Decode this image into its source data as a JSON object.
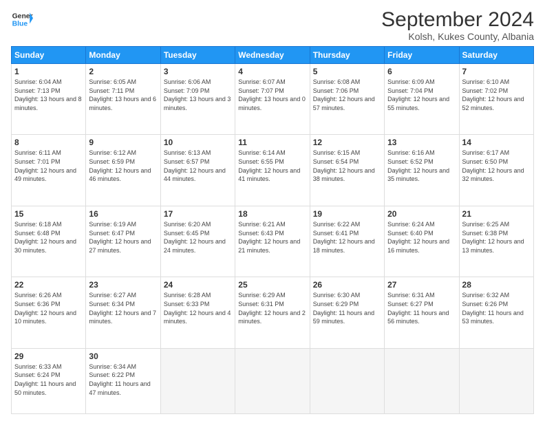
{
  "logo": {
    "general": "General",
    "blue": "Blue"
  },
  "title": "September 2024",
  "location": "Kolsh, Kukes County, Albania",
  "days_of_week": [
    "Sunday",
    "Monday",
    "Tuesday",
    "Wednesday",
    "Thursday",
    "Friday",
    "Saturday"
  ],
  "weeks": [
    [
      {
        "day": "1",
        "sunrise": "6:04 AM",
        "sunset": "7:13 PM",
        "daylight": "13 hours and 8 minutes."
      },
      {
        "day": "2",
        "sunrise": "6:05 AM",
        "sunset": "7:11 PM",
        "daylight": "13 hours and 6 minutes."
      },
      {
        "day": "3",
        "sunrise": "6:06 AM",
        "sunset": "7:09 PM",
        "daylight": "13 hours and 3 minutes."
      },
      {
        "day": "4",
        "sunrise": "6:07 AM",
        "sunset": "7:07 PM",
        "daylight": "13 hours and 0 minutes."
      },
      {
        "day": "5",
        "sunrise": "6:08 AM",
        "sunset": "7:06 PM",
        "daylight": "12 hours and 57 minutes."
      },
      {
        "day": "6",
        "sunrise": "6:09 AM",
        "sunset": "7:04 PM",
        "daylight": "12 hours and 55 minutes."
      },
      {
        "day": "7",
        "sunrise": "6:10 AM",
        "sunset": "7:02 PM",
        "daylight": "12 hours and 52 minutes."
      }
    ],
    [
      {
        "day": "8",
        "sunrise": "6:11 AM",
        "sunset": "7:01 PM",
        "daylight": "12 hours and 49 minutes."
      },
      {
        "day": "9",
        "sunrise": "6:12 AM",
        "sunset": "6:59 PM",
        "daylight": "12 hours and 46 minutes."
      },
      {
        "day": "10",
        "sunrise": "6:13 AM",
        "sunset": "6:57 PM",
        "daylight": "12 hours and 44 minutes."
      },
      {
        "day": "11",
        "sunrise": "6:14 AM",
        "sunset": "6:55 PM",
        "daylight": "12 hours and 41 minutes."
      },
      {
        "day": "12",
        "sunrise": "6:15 AM",
        "sunset": "6:54 PM",
        "daylight": "12 hours and 38 minutes."
      },
      {
        "day": "13",
        "sunrise": "6:16 AM",
        "sunset": "6:52 PM",
        "daylight": "12 hours and 35 minutes."
      },
      {
        "day": "14",
        "sunrise": "6:17 AM",
        "sunset": "6:50 PM",
        "daylight": "12 hours and 32 minutes."
      }
    ],
    [
      {
        "day": "15",
        "sunrise": "6:18 AM",
        "sunset": "6:48 PM",
        "daylight": "12 hours and 30 minutes."
      },
      {
        "day": "16",
        "sunrise": "6:19 AM",
        "sunset": "6:47 PM",
        "daylight": "12 hours and 27 minutes."
      },
      {
        "day": "17",
        "sunrise": "6:20 AM",
        "sunset": "6:45 PM",
        "daylight": "12 hours and 24 minutes."
      },
      {
        "day": "18",
        "sunrise": "6:21 AM",
        "sunset": "6:43 PM",
        "daylight": "12 hours and 21 minutes."
      },
      {
        "day": "19",
        "sunrise": "6:22 AM",
        "sunset": "6:41 PM",
        "daylight": "12 hours and 18 minutes."
      },
      {
        "day": "20",
        "sunrise": "6:24 AM",
        "sunset": "6:40 PM",
        "daylight": "12 hours and 16 minutes."
      },
      {
        "day": "21",
        "sunrise": "6:25 AM",
        "sunset": "6:38 PM",
        "daylight": "12 hours and 13 minutes."
      }
    ],
    [
      {
        "day": "22",
        "sunrise": "6:26 AM",
        "sunset": "6:36 PM",
        "daylight": "12 hours and 10 minutes."
      },
      {
        "day": "23",
        "sunrise": "6:27 AM",
        "sunset": "6:34 PM",
        "daylight": "12 hours and 7 minutes."
      },
      {
        "day": "24",
        "sunrise": "6:28 AM",
        "sunset": "6:33 PM",
        "daylight": "12 hours and 4 minutes."
      },
      {
        "day": "25",
        "sunrise": "6:29 AM",
        "sunset": "6:31 PM",
        "daylight": "12 hours and 2 minutes."
      },
      {
        "day": "26",
        "sunrise": "6:30 AM",
        "sunset": "6:29 PM",
        "daylight": "11 hours and 59 minutes."
      },
      {
        "day": "27",
        "sunrise": "6:31 AM",
        "sunset": "6:27 PM",
        "daylight": "11 hours and 56 minutes."
      },
      {
        "day": "28",
        "sunrise": "6:32 AM",
        "sunset": "6:26 PM",
        "daylight": "11 hours and 53 minutes."
      }
    ],
    [
      {
        "day": "29",
        "sunrise": "6:33 AM",
        "sunset": "6:24 PM",
        "daylight": "11 hours and 50 minutes."
      },
      {
        "day": "30",
        "sunrise": "6:34 AM",
        "sunset": "6:22 PM",
        "daylight": "11 hours and 47 minutes."
      },
      null,
      null,
      null,
      null,
      null
    ]
  ]
}
